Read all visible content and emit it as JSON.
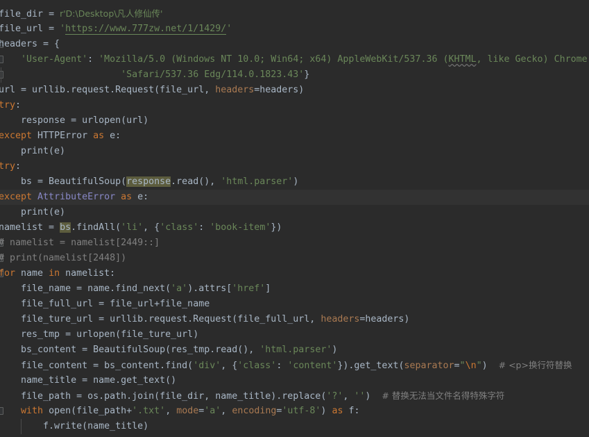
{
  "editor": {
    "language": "Python",
    "theme": "Darcula",
    "colors": {
      "background": "#2b2b2b",
      "current_line": "#323232",
      "default_text": "#a9b7c6",
      "keyword": "#cc7832",
      "string": "#6a8759",
      "comment": "#808080",
      "number": "#6897bb",
      "builtin": "#8888c6",
      "named_arg": "#aa7a52",
      "occurrence_highlight": "#5c5c3d",
      "fold_marker": "#5e6060"
    },
    "caret_line": 14
  },
  "code": {
    "lines": [
      {
        "n": 1,
        "tokens": [
          {
            "t": "file_dir ",
            "c": "def"
          },
          {
            "t": "= ",
            "c": "def"
          },
          {
            "t": "r'D:\\Desktop\\凡人修仙传'",
            "c": "str"
          }
        ]
      },
      {
        "n": 2,
        "tokens": [
          {
            "t": "file_url ",
            "c": "def"
          },
          {
            "t": "= ",
            "c": "def"
          },
          {
            "t": "'",
            "c": "str"
          },
          {
            "t": "https://www.777zw.net/1/1429/",
            "c": "url"
          },
          {
            "t": "'",
            "c": "str"
          }
        ]
      },
      {
        "n": 3,
        "fold": true,
        "tokens": [
          {
            "t": "headers = {",
            "c": "def"
          }
        ]
      },
      {
        "n": 4,
        "fold": true,
        "tokens": [
          {
            "t": "    ",
            "c": "def"
          },
          {
            "t": "'User-Agent'",
            "c": "str"
          },
          {
            "t": ": ",
            "c": "def"
          },
          {
            "t": "'Mozilla/5.0 (Windows NT 10.0; Win64; x64) AppleWebKit/537.36 (",
            "c": "str"
          },
          {
            "t": "KHTML",
            "c": "str spell"
          },
          {
            "t": ", like Gecko) Chrome",
            "c": "str"
          }
        ]
      },
      {
        "n": 5,
        "fold": true,
        "guides": [
          1
        ],
        "tokens": [
          {
            "t": "                      ",
            "c": "def"
          },
          {
            "t": "'Safari/537.36 Edg/114.0.1823.43'",
            "c": "str"
          },
          {
            "t": "}",
            "c": "def"
          }
        ]
      },
      {
        "n": 6,
        "tokens": [
          {
            "t": "url = urllib.request.Request(file_url, ",
            "c": "def"
          },
          {
            "t": "headers",
            "c": "arg"
          },
          {
            "t": "=headers)",
            "c": "def"
          }
        ]
      },
      {
        "n": 7,
        "tokens": [
          {
            "t": "try",
            "c": "kw"
          },
          {
            "t": ":",
            "c": "def"
          }
        ]
      },
      {
        "n": 8,
        "tokens": [
          {
            "t": "    response = urlopen(url)",
            "c": "def"
          }
        ]
      },
      {
        "n": 9,
        "tokens": [
          {
            "t": "except ",
            "c": "kw"
          },
          {
            "t": "HTTPError ",
            "c": "def"
          },
          {
            "t": "as ",
            "c": "kw"
          },
          {
            "t": "e:",
            "c": "def"
          }
        ]
      },
      {
        "n": 10,
        "tokens": [
          {
            "t": "    print(e)",
            "c": "def"
          }
        ]
      },
      {
        "n": 11,
        "tokens": [
          {
            "t": "try",
            "c": "kw"
          },
          {
            "t": ":",
            "c": "def"
          }
        ]
      },
      {
        "n": 12,
        "tokens": [
          {
            "t": "    bs = BeautifulSoup(",
            "c": "def"
          },
          {
            "t": "response",
            "c": "def occ"
          },
          {
            "t": ".read(), ",
            "c": "def"
          },
          {
            "t": "'html.parser'",
            "c": "str"
          },
          {
            "t": ")",
            "c": "def"
          }
        ]
      },
      {
        "n": 13,
        "current": true,
        "tokens": [
          {
            "t": "except ",
            "c": "kw"
          },
          {
            "t": "AttributeError ",
            "c": "bi"
          },
          {
            "t": "as ",
            "c": "kw"
          },
          {
            "t": "e:",
            "c": "def"
          }
        ]
      },
      {
        "n": 14,
        "tokens": [
          {
            "t": "    print(e)",
            "c": "def"
          }
        ]
      },
      {
        "n": 15,
        "tokens": [
          {
            "t": "namelist = ",
            "c": "def"
          },
          {
            "t": "bs",
            "c": "def occ"
          },
          {
            "t": ".findAll(",
            "c": "def"
          },
          {
            "t": "'li'",
            "c": "str"
          },
          {
            "t": ", {",
            "c": "def"
          },
          {
            "t": "'class'",
            "c": "str"
          },
          {
            "t": ": ",
            "c": "def"
          },
          {
            "t": "'book-item'",
            "c": "str"
          },
          {
            "t": "})",
            "c": "def"
          }
        ]
      },
      {
        "n": 16,
        "fold": true,
        "tokens": [
          {
            "t": "# namelist = namelist[2449::]",
            "c": "cmt"
          }
        ]
      },
      {
        "n": 17,
        "fold": true,
        "tokens": [
          {
            "t": "# print(namelist[2448])",
            "c": "cmt"
          }
        ]
      },
      {
        "n": 18,
        "fold": true,
        "tokens": [
          {
            "t": "for ",
            "c": "kw"
          },
          {
            "t": "name ",
            "c": "def"
          },
          {
            "t": "in ",
            "c": "kw"
          },
          {
            "t": "namelist:",
            "c": "def"
          }
        ]
      },
      {
        "n": 19,
        "tokens": [
          {
            "t": "    file_name = name.find_next(",
            "c": "def"
          },
          {
            "t": "'a'",
            "c": "str"
          },
          {
            "t": ").attrs[",
            "c": "def"
          },
          {
            "t": "'href'",
            "c": "str"
          },
          {
            "t": "]",
            "c": "def"
          }
        ]
      },
      {
        "n": 20,
        "tokens": [
          {
            "t": "    file_full_url = file_url+file_name",
            "c": "def"
          }
        ]
      },
      {
        "n": 21,
        "tokens": [
          {
            "t": "    file_ture_url = urllib.request.Request(file_full_url, ",
            "c": "def"
          },
          {
            "t": "headers",
            "c": "arg"
          },
          {
            "t": "=headers)",
            "c": "def"
          }
        ]
      },
      {
        "n": 22,
        "tokens": [
          {
            "t": "    res_tmp = urlopen(file_ture_url)",
            "c": "def"
          }
        ]
      },
      {
        "n": 23,
        "tokens": [
          {
            "t": "    bs_content = BeautifulSoup(res_tmp.read(), ",
            "c": "def"
          },
          {
            "t": "'html.parser'",
            "c": "str"
          },
          {
            "t": ")",
            "c": "def"
          }
        ]
      },
      {
        "n": 24,
        "tokens": [
          {
            "t": "    file_content = bs_content.find(",
            "c": "def"
          },
          {
            "t": "'div'",
            "c": "str"
          },
          {
            "t": ", {",
            "c": "def"
          },
          {
            "t": "'class'",
            "c": "str"
          },
          {
            "t": ": ",
            "c": "def"
          },
          {
            "t": "'content'",
            "c": "str"
          },
          {
            "t": "}).get_text(",
            "c": "def"
          },
          {
            "t": "separator",
            "c": "arg"
          },
          {
            "t": "=",
            "c": "def"
          },
          {
            "t": "\"",
            "c": "str"
          },
          {
            "t": "\\n",
            "c": "esc"
          },
          {
            "t": "\"",
            "c": "str"
          },
          {
            "t": ")  ",
            "c": "def"
          },
          {
            "t": "# <p>换行符替换",
            "c": "cmt"
          }
        ]
      },
      {
        "n": 25,
        "tokens": [
          {
            "t": "    name_title = name.get_text()",
            "c": "def"
          }
        ]
      },
      {
        "n": 26,
        "tokens": [
          {
            "t": "    file_path = os.path.join(file_dir, name_title).replace(",
            "c": "def"
          },
          {
            "t": "'?'",
            "c": "str"
          },
          {
            "t": ", ",
            "c": "def"
          },
          {
            "t": "''",
            "c": "str"
          },
          {
            "t": ")  ",
            "c": "def"
          },
          {
            "t": "# 替换无法当文件名得特殊字符",
            "c": "cmt"
          }
        ]
      },
      {
        "n": 27,
        "fold": true,
        "tokens": [
          {
            "t": "    ",
            "c": "def"
          },
          {
            "t": "with ",
            "c": "kw"
          },
          {
            "t": "open(file_path+",
            "c": "def"
          },
          {
            "t": "'.txt'",
            "c": "str"
          },
          {
            "t": ", ",
            "c": "def"
          },
          {
            "t": "mode",
            "c": "arg"
          },
          {
            "t": "=",
            "c": "def"
          },
          {
            "t": "'a'",
            "c": "str"
          },
          {
            "t": ", ",
            "c": "def"
          },
          {
            "t": "encoding",
            "c": "arg"
          },
          {
            "t": "=",
            "c": "def"
          },
          {
            "t": "'utf-8'",
            "c": "str"
          },
          {
            "t": ") ",
            "c": "def"
          },
          {
            "t": "as ",
            "c": "kw"
          },
          {
            "t": "f:",
            "c": "def"
          }
        ]
      },
      {
        "n": 28,
        "guides": [
          2
        ],
        "tokens": [
          {
            "t": "        f.write(name_title)",
            "c": "def"
          }
        ]
      }
    ]
  }
}
